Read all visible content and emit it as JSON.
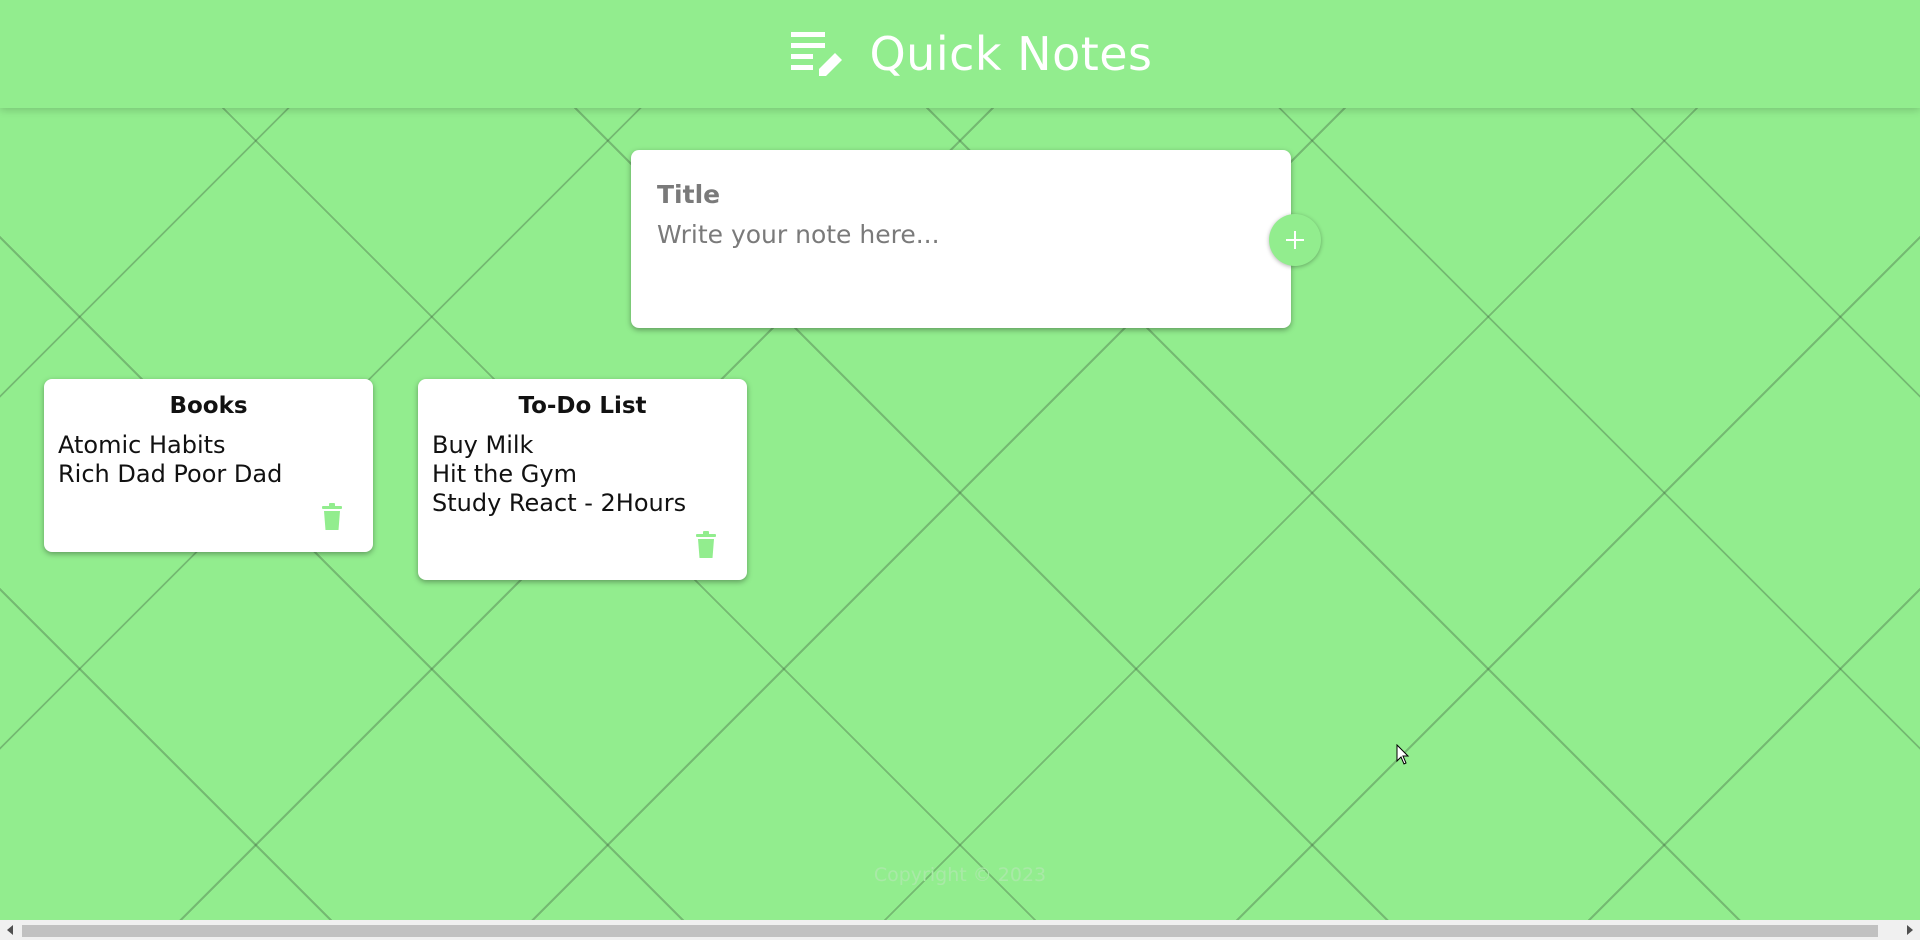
{
  "header": {
    "title": "Quick Notes",
    "icon": "notes-edit-icon"
  },
  "compose": {
    "title_placeholder": "Title",
    "content_placeholder": "Write your note here...",
    "add_icon": "plus-icon"
  },
  "notes": [
    {
      "title": "Books",
      "lines": [
        "Atomic Habits",
        "Rich Dad Poor Dad"
      ],
      "delete_icon": "trash-icon"
    },
    {
      "title": "To-Do List",
      "lines": [
        "Buy Milk",
        "Hit the Gym",
        "Study React - 2Hours"
      ],
      "delete_icon": "trash-icon"
    }
  ],
  "footer": {
    "copyright": "Copyright © 2023"
  },
  "colors": {
    "accent": "#92ed8e",
    "card": "#ffffff",
    "footer_text": "#a9e9a7"
  }
}
